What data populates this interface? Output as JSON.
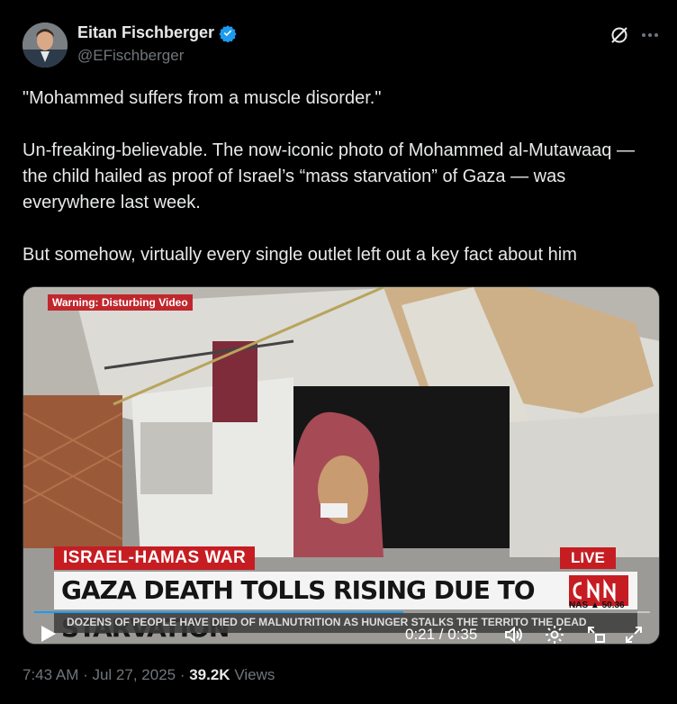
{
  "author": {
    "name": "Eitan Fischberger",
    "handle": "@EFischberger"
  },
  "tweet": {
    "line1": "\"Mohammed suffers from a muscle disorder.\"",
    "paragraph2": "Un-freaking-believable. The now-iconic photo of Mohammed al-Mutawaaq — the child hailed as proof of Israel’s “mass starvation” of Gaza — was everywhere last week.",
    "paragraph3": "But somehow, virtually every single outlet left out a key fact about him"
  },
  "video": {
    "warning": "Warning: Disturbing Video",
    "topic": "ISRAEL-HAMAS WAR",
    "live": "LIVE",
    "headline": "GAZA DEATH TOLLS RISING DUE TO STARVATION",
    "ticker": "DOZENS OF PEOPLE HAVE DIED OF MALNUTRITION AS HUNGER STALKS THE TERRITO THE DEAD",
    "nas": "NAS ▲ 50.36",
    "time": "0:21 / 0:35",
    "progress": 0.6
  },
  "meta": {
    "timestamp": "7:43 AM · Jul 27, 2025 · ",
    "views_count": "39.2K",
    "views_label": " Views"
  },
  "colors": {
    "background": "#000000",
    "text": "#e7e9ea",
    "secondary": "#71767b",
    "verified": "#1d9bf0",
    "cnn_red": "#c61d23"
  }
}
